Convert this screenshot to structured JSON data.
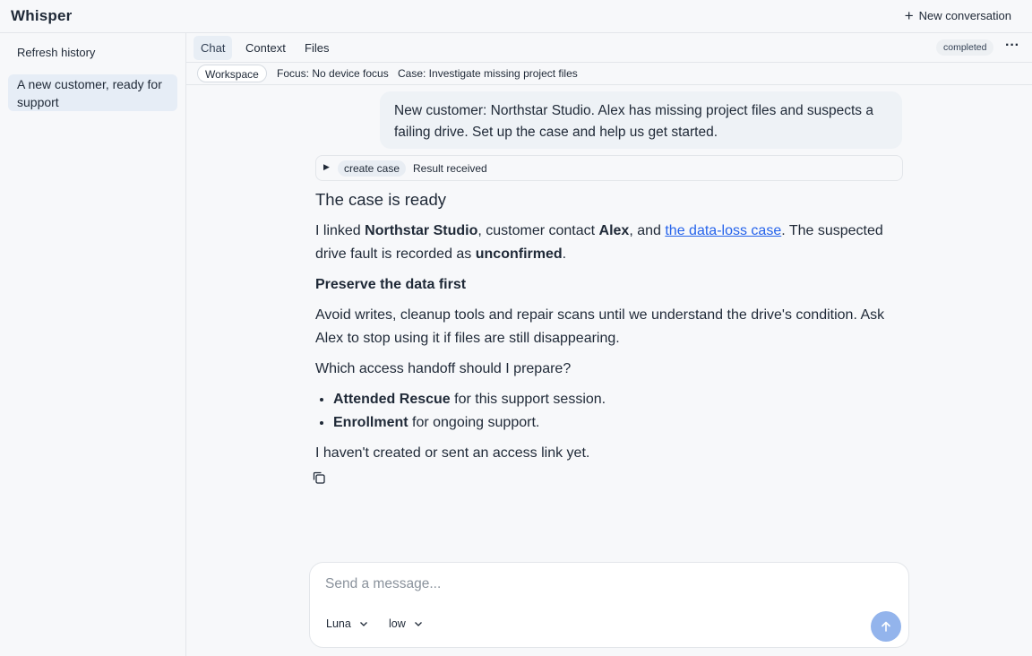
{
  "app": {
    "title": "Whisper",
    "new_conversation": "New conversation"
  },
  "sidebar": {
    "refresh": "Refresh history",
    "conversations": [
      {
        "title": "A new customer, ready for support"
      }
    ]
  },
  "tabs": [
    {
      "label": "Chat",
      "active": true
    },
    {
      "label": "Context"
    },
    {
      "label": "Files"
    }
  ],
  "status": "completed",
  "context": {
    "workspace": "Workspace",
    "focus": "Focus: No device focus",
    "case": "Case: Investigate missing project files"
  },
  "messages": {
    "user": "New customer: Northstar Studio. Alex has missing project files and suspects a failing drive. Set up the case and help us get started.",
    "tool": {
      "name": "create case",
      "status": "Result received"
    },
    "assistant": {
      "heading": "The case is ready",
      "p1_a": "I linked ",
      "p1_company": "Northstar Studio",
      "p1_b": ", customer contact ",
      "p1_contact": "Alex",
      "p1_c": ", and ",
      "p1_link": "the data-loss case",
      "p1_d": ". The suspected drive fault is recorded as ",
      "p1_state": "unconfirmed",
      "p1_e": ".",
      "subheading": "Preserve the data first",
      "p2": "Avoid writes, cleanup tools and repair scans until we understand the drive's condition. Ask Alex to stop using it if files are still disappearing.",
      "question": "Which access handoff should I prepare?",
      "options": [
        {
          "name": "Attended Rescue",
          "desc": " for this support session."
        },
        {
          "name": "Enrollment",
          "desc": " for ongoing support."
        }
      ],
      "footer": "I haven't created or sent an access link yet."
    }
  },
  "composer": {
    "placeholder": "Send a message...",
    "model": "Luna",
    "effort": "low"
  },
  "colors": {
    "accent": "#2563eb",
    "send_button": "#93b4ec",
    "selected_item": "#e6edf6"
  }
}
